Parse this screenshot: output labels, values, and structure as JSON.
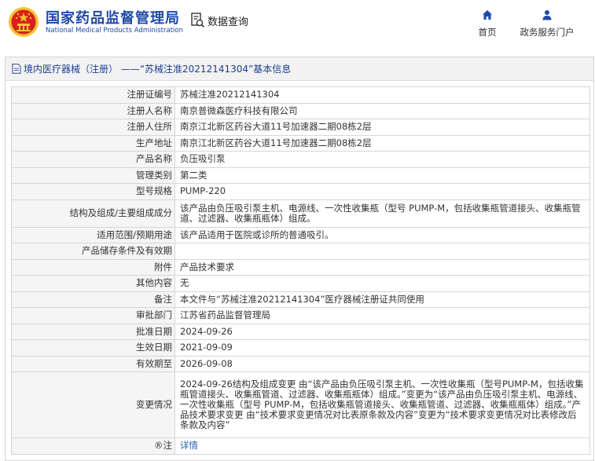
{
  "header": {
    "brand_cn": "国家药品监督管理局",
    "brand_en": "National Medical Products Administration",
    "search_label": "数据查询",
    "nav": [
      {
        "label": "首页",
        "icon": "home-icon"
      },
      {
        "label": "政务服务门户",
        "icon": "user-icon"
      }
    ]
  },
  "panel": {
    "title": "境内医疗器械（注册） ——“苏械注准20212141304”基本信息"
  },
  "rows": [
    {
      "label": "注册证编号",
      "value": "苏械注准20212141304"
    },
    {
      "label": "注册人名称",
      "value": "南京普微森医疗科技有限公司"
    },
    {
      "label": "注册人住所",
      "value": "南京江北新区药谷大道11号加速器二期08栋2层"
    },
    {
      "label": "生产地址",
      "value": "南京江北新区药谷大道11号加速器二期08栋2层"
    },
    {
      "label": "产品名称",
      "value": "负压吸引泵"
    },
    {
      "label": "管理类别",
      "value": "第二类"
    },
    {
      "label": "型号规格",
      "value": "PUMP-220"
    },
    {
      "label": "结构及组成/主要组成成分",
      "value": "该产品由负压吸引泵主机、电源线、一次性收集瓶（型号 PUMP-M，包括收集瓶管道接头、收集瓶管道、过滤器、收集瓶瓶体）组成。"
    },
    {
      "label": "适用范围/预期用途",
      "value": "该产品适用于医院或诊所的普通吸引。"
    },
    {
      "label": "产品储存条件及有效期",
      "value": ""
    },
    {
      "label": "附件",
      "value": "产品技术要求"
    },
    {
      "label": "其他内容",
      "value": "无"
    },
    {
      "label": "备注",
      "value": "本文件与“苏械注准20212141304”医疗器械注册证共同使用"
    },
    {
      "label": "审批部门",
      "value": "江苏省药品监督管理局"
    },
    {
      "label": "批准日期",
      "value": "2024-09-26"
    },
    {
      "label": "生效日期",
      "value": "2021-09-09"
    },
    {
      "label": "有效期至",
      "value": "2026-09-08"
    },
    {
      "label": "变更情况",
      "value": "2024-09-26结构及组成变更 由“该产品由负压吸引泵主机、一次性收集瓶（型号PUMP-M，包括收集瓶管道接头、收集瓶管道、过滤器、收集瓶瓶体）组成。”变更为“该产品由负压吸引泵主机、电源线、一次性收集瓶（型号 PUMP-M，包括收集瓶管道接头、收集瓶管道、过滤器、收集瓶瓶体）组成。”产品技术要求变更 由“技术要求变更情况对比表原条款及内容”变更为“技术要求变更情况对比表修改后条款及内容”"
    },
    {
      "label": "®注",
      "value": "详情"
    }
  ],
  "colors": {
    "brand_blue": "#1e4aa8",
    "emblem_red": "#d8201e",
    "emblem_gold": "#f4c430",
    "link_blue": "#1e5fbf"
  }
}
